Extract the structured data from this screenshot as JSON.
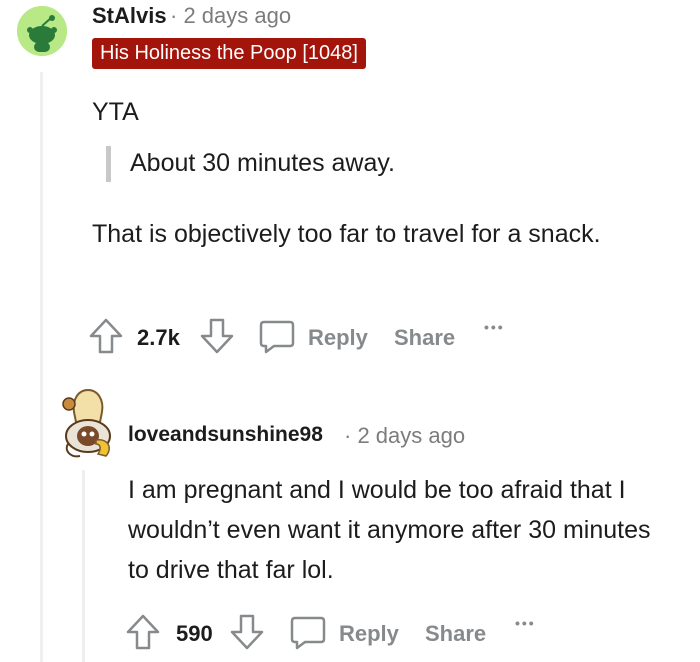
{
  "comment1": {
    "username": "StAlvis",
    "separator": "·",
    "timestamp": "2 days ago",
    "flair": "His Holiness the Poop [1048]",
    "flair_color": "#a3140b",
    "avatar_color": "#b8e986",
    "body_line1": "YTA",
    "quote": "About 30 minutes away.",
    "body_para": "That is objectively too far to travel for a snack.",
    "votes": "2.7k",
    "reply_label": "Reply",
    "share_label": "Share",
    "more_label": "•••"
  },
  "comment2": {
    "username": "loveandsunshine98",
    "separator": "·",
    "timestamp": "2 days ago",
    "body_para": "I am pregnant and I would be too afraid that I wouldn’t even want it anymore after 30 minutes to drive that far lol.",
    "votes": "590",
    "reply_label": "Reply",
    "share_label": "Share",
    "more_label": "•••"
  },
  "icons": {
    "upvote": "upvote-icon",
    "downvote": "downvote-icon",
    "comment": "comment-bubble-icon",
    "more": "more-dots-icon"
  }
}
